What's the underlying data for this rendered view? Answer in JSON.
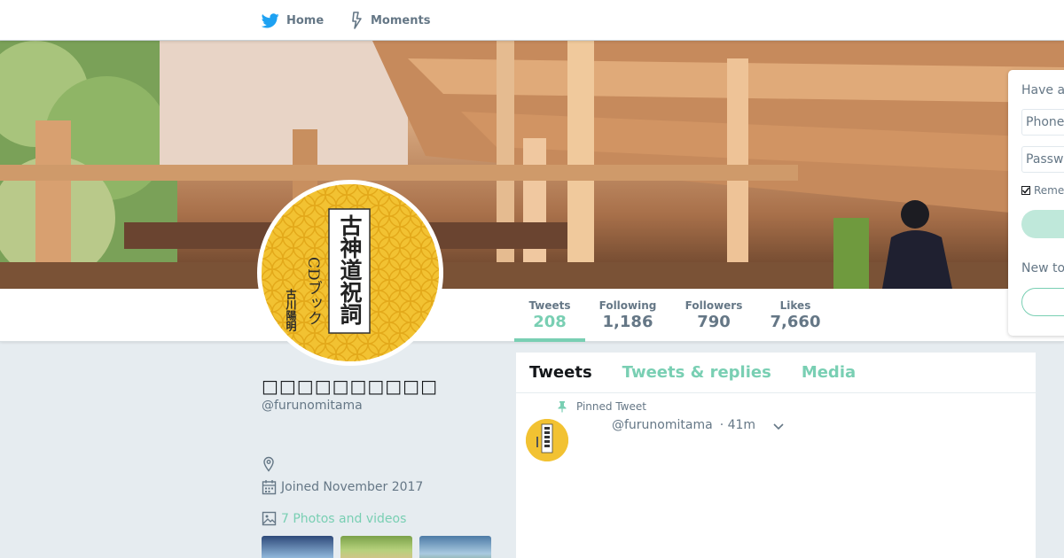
{
  "nav": {
    "home_label": "Home",
    "moments_label": "Moments"
  },
  "colors": {
    "accent": "#79cfb3",
    "twitter_blue": "#1da1f2",
    "avatar_yellow": "#f2c232"
  },
  "profile": {
    "display_name": "□□□□□□□□□□",
    "handle": "@furunomitama",
    "joined": "Joined November 2017",
    "photos_link": "7 Photos and videos",
    "avatar_text": {
      "title": "古神道祝詞",
      "subtitle": "CDブック",
      "author": "古川陽明"
    }
  },
  "stats": [
    {
      "label": "Tweets",
      "value": "208"
    },
    {
      "label": "Following",
      "value": "1,186"
    },
    {
      "label": "Followers",
      "value": "790"
    },
    {
      "label": "Likes",
      "value": "7,660"
    }
  ],
  "timeline": {
    "tabs": [
      "Tweets",
      "Tweets & replies",
      "Media"
    ],
    "pinned_label": "Pinned Tweet",
    "tweet": {
      "handle": "@furunomitama",
      "time": "· 41m"
    }
  },
  "login": {
    "title": "Have a",
    "phone_placeholder": "Phone",
    "password_placeholder": "Passw",
    "remember": "Reme",
    "new_to": "New to"
  }
}
